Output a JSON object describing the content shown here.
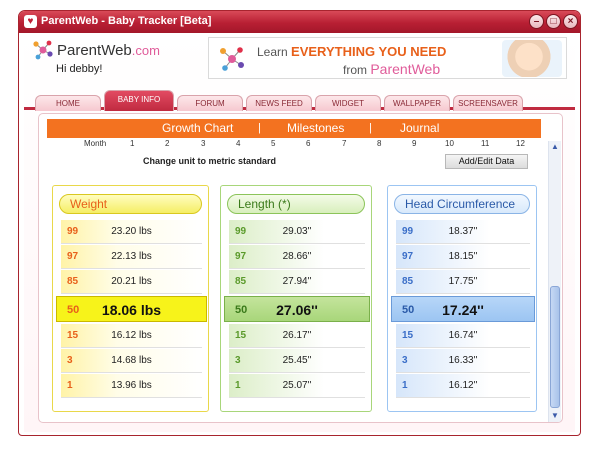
{
  "window": {
    "title": "ParentWeb - Baby Tracker [Beta]",
    "controls": [
      "–",
      "□",
      "×"
    ]
  },
  "header": {
    "logo_text": "ParentWeb",
    "logo_suffix": ".com",
    "greeting": "Hi debby!",
    "banner_line1_prefix": "Learn",
    "banner_line1_emphasis": "EVERYTHING YOU NEED",
    "banner_line2_prefix": "from",
    "banner_line2_brand": "ParentWeb"
  },
  "tabs": [
    {
      "label": "HOME",
      "active": false
    },
    {
      "label": "BABY INFO",
      "active": true
    },
    {
      "label": "FORUM",
      "active": false
    },
    {
      "label": "NEWS FEED",
      "active": false
    },
    {
      "label": "WIDGET",
      "active": false
    },
    {
      "label": "WALLPAPER",
      "active": false
    },
    {
      "label": "SCREENSAVER",
      "active": false
    }
  ],
  "nav": {
    "items": [
      "Growth Chart",
      "Milestones",
      "Journal"
    ],
    "separator": "|"
  },
  "axis": {
    "label": "Month",
    "ticks": [
      "1",
      "2",
      "3",
      "4",
      "5",
      "6",
      "7",
      "8",
      "9",
      "10",
      "11",
      "12"
    ]
  },
  "unit_link": "Change unit to metric standard",
  "add_edit_button": "Add/Edit Data",
  "scrollbar": {
    "up": "▲",
    "down": "▼"
  },
  "panels": [
    {
      "title": "Weight",
      "rows": [
        {
          "pct": "99",
          "value": "23.20  lbs"
        },
        {
          "pct": "97",
          "value": "22.13  lbs"
        },
        {
          "pct": "85",
          "value": "20.21  lbs"
        },
        {
          "pct": "50",
          "value": "18.06  lbs"
        },
        {
          "pct": "15",
          "value": "16.12  lbs"
        },
        {
          "pct": "3",
          "value": "14.68  lbs"
        },
        {
          "pct": "1",
          "value": "13.96  lbs"
        }
      ]
    },
    {
      "title": "Length (*)",
      "rows": [
        {
          "pct": "99",
          "value": "29.03''"
        },
        {
          "pct": "97",
          "value": "28.66''"
        },
        {
          "pct": "85",
          "value": "27.94''"
        },
        {
          "pct": "50",
          "value": "27.06''"
        },
        {
          "pct": "15",
          "value": "26.17''"
        },
        {
          "pct": "3",
          "value": "25.45''"
        },
        {
          "pct": "1",
          "value": "25.07''"
        }
      ]
    },
    {
      "title": "Head Circumference",
      "rows": [
        {
          "pct": "99",
          "value": "18.37''"
        },
        {
          "pct": "97",
          "value": "18.15''"
        },
        {
          "pct": "85",
          "value": "17.75''"
        },
        {
          "pct": "50",
          "value": "17.24''"
        },
        {
          "pct": "15",
          "value": "16.74''"
        },
        {
          "pct": "3",
          "value": "16.33''"
        },
        {
          "pct": "1",
          "value": "16.12''"
        }
      ]
    }
  ],
  "colors": {
    "titlebar": "#b81f33",
    "nav_orange": "#f37220",
    "weight_accent": "#f7f31a",
    "length_accent": "#a8d67a",
    "head_accent": "#9cc5f2",
    "percentile_orange": "#e8601a",
    "percentile_green": "#5a9a2a",
    "percentile_blue": "#3a6ec8"
  }
}
